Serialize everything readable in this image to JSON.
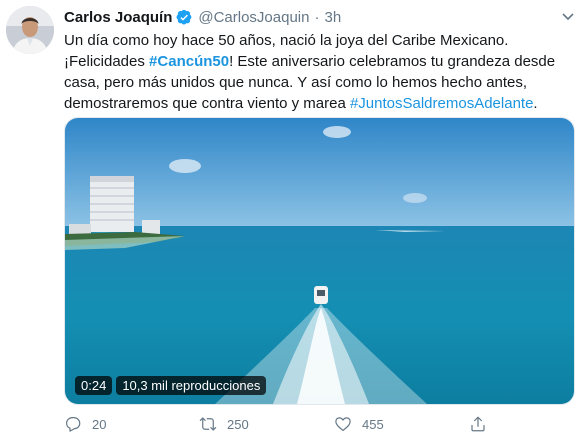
{
  "tweet": {
    "author_name": "Carlos Joaquín",
    "handle": "@CarlosJoaquin",
    "separator": "·",
    "time": "3h",
    "verified_icon": "verified-badge-icon",
    "text": {
      "line1": "Un día como hoy hace 50 años, nació la joya del Caribe Mexicano.",
      "line2_pre": "¡Felicidades ",
      "hashtag1": "#Cancún50",
      "line2_post": "! Este aniversario celebramos tu grandeza desde",
      "line3": "casa, pero más unidos que nunca. Y así como lo hemos hecho antes,",
      "line4_pre": "demostraremos que contra viento y marea ",
      "hashtag2": "#JuntosSaldremosAdelante",
      "line4_post": "."
    },
    "video": {
      "duration": "0:24",
      "views": "10,3 mil reproducciones"
    },
    "actions": {
      "replies": "20",
      "retweets": "250",
      "likes": "455"
    }
  },
  "colors": {
    "link": "#1b95e0",
    "muted": "#657786",
    "verified": "#1da1f2"
  }
}
